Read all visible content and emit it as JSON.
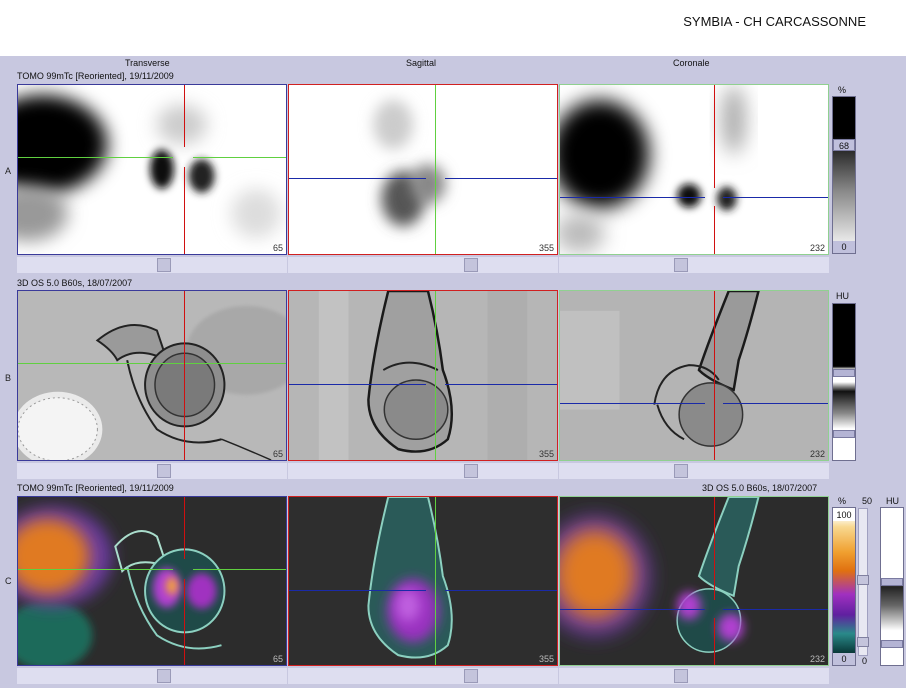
{
  "header": {
    "site": "SYMBIA - CH CARCASSONNE"
  },
  "columns": {
    "transverse": "Transverse",
    "sagittal": "Sagittal",
    "coronal": "Coronale"
  },
  "rows": {
    "a": {
      "letter": "A",
      "series": "TOMO 99mTc [Reoriented], 19/11/2009"
    },
    "b": {
      "letter": "B",
      "series": "3D  OS  5.0  B60s, 18/07/2007"
    },
    "c": {
      "letter": "C",
      "series_left": "TOMO 99mTc [Reoriented], 19/11/2009",
      "series_right": "3D  OS  5.0  B60s, 18/07/2007"
    }
  },
  "slice_numbers": {
    "transverse": "65",
    "sagittal": "355",
    "coronal": "232"
  },
  "colorbars": {
    "a": {
      "unit": "%",
      "top": "68",
      "bottom": "0"
    },
    "b": {
      "unit": "HU"
    },
    "c": {
      "unit": "%",
      "top": "100",
      "bottom": "0",
      "slider_top": "50",
      "slider_bottom": "0",
      "unit2": "HU"
    }
  },
  "colors": {
    "transverse_border": "#3a3a9a",
    "sagittal_border": "#d02020",
    "coronal_border": "#90d090",
    "cursor_red": "#d01010",
    "cursor_green": "#60d040",
    "cursor_blue": "#1a2aa8"
  }
}
